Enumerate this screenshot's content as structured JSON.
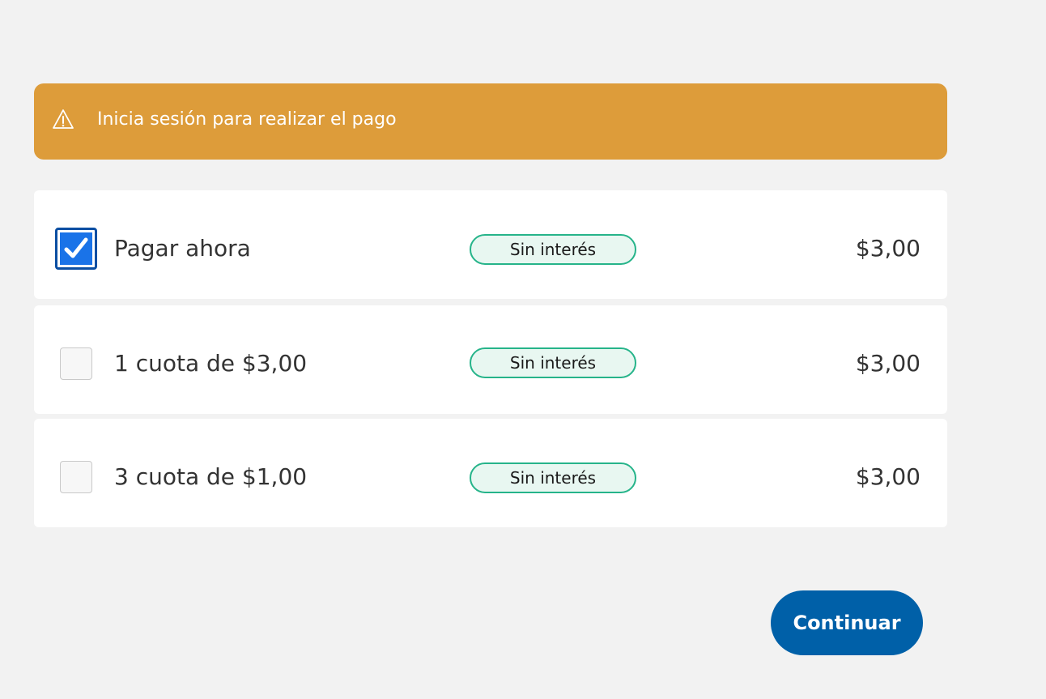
{
  "alert": {
    "icon": "warning-icon",
    "message": "Inicia sesión para realizar el pago",
    "color": "#dd9c3a"
  },
  "options": [
    {
      "label": "Pagar ahora",
      "badge": "Sin interés",
      "amount": "$3,00",
      "selected": true
    },
    {
      "label": "1 cuota de $3,00",
      "badge": "Sin interés",
      "amount": "$3,00",
      "selected": false
    },
    {
      "label": "3 cuota de $1,00",
      "badge": "Sin interés",
      "amount": "$3,00",
      "selected": false
    }
  ],
  "actions": {
    "continue_label": "Continuar"
  },
  "colors": {
    "background": "#f2f2f2",
    "primary": "#0060a8",
    "checkbox_checked": "#1a73e8",
    "badge_border": "#26b48a"
  }
}
